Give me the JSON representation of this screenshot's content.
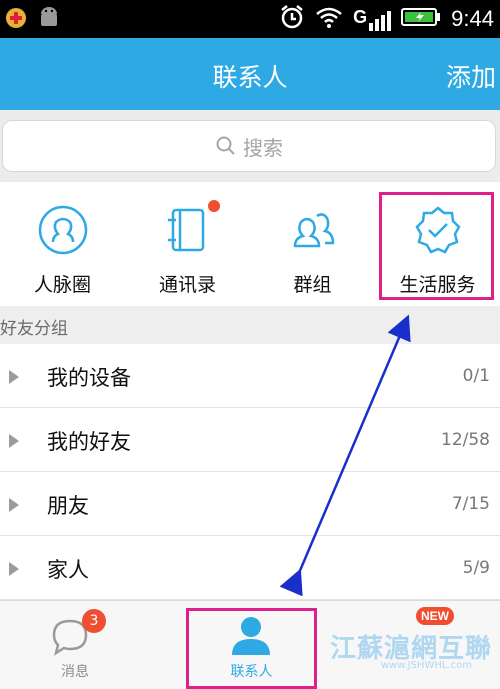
{
  "status_bar": {
    "time": "9:44",
    "network": "G"
  },
  "header": {
    "title": "联系人",
    "add_label": "添加"
  },
  "search": {
    "placeholder": "搜索"
  },
  "quick_entries": [
    {
      "label": "人脉圈",
      "icon": "face-circle-icon"
    },
    {
      "label": "通讯录",
      "icon": "address-book-icon"
    },
    {
      "label": "群组",
      "icon": "people-group-icon"
    },
    {
      "label": "生活服务",
      "icon": "verified-badge-icon"
    }
  ],
  "group_section": {
    "title": "好友分组"
  },
  "groups": [
    {
      "name": "我的设备",
      "count": "0/1"
    },
    {
      "name": "我的好友",
      "count": "12/58"
    },
    {
      "name": "朋友",
      "count": "7/15"
    },
    {
      "name": "家人",
      "count": "5/9"
    }
  ],
  "tabs": [
    {
      "label": "消息",
      "badge": "3"
    },
    {
      "label": "联系人"
    },
    {
      "label": "",
      "badge": "NEW"
    }
  ],
  "watermark": {
    "text": "江蘇滬網互聯",
    "sub": "www.JSHWHL.com"
  },
  "colors": {
    "header": "#2ea9e4",
    "highlight": "#e0208a",
    "badge": "#f04e30",
    "arrow": "#1a2fc9"
  }
}
